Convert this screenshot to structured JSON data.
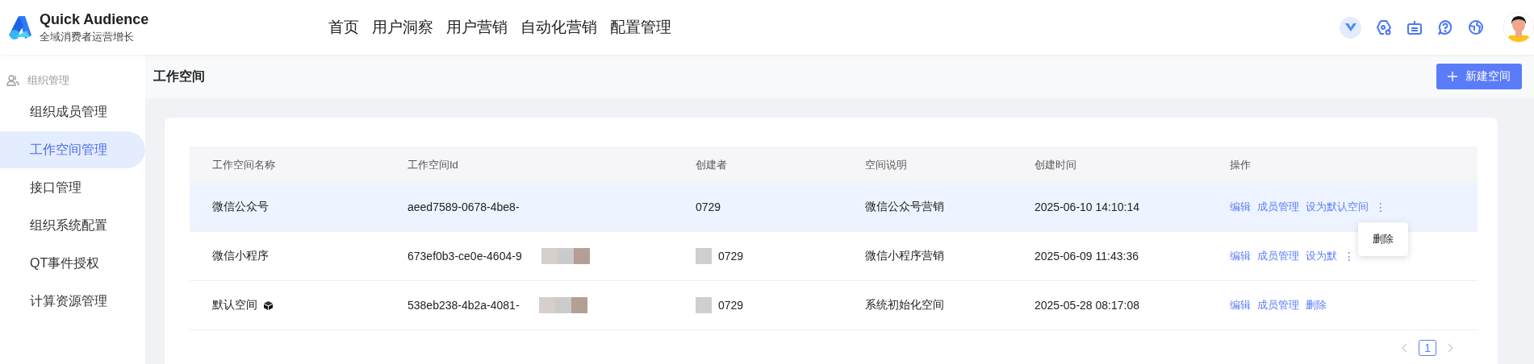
{
  "app": {
    "name": "Quick Audience",
    "tagline": "全域消费者运营增长"
  },
  "nav": [
    {
      "label": "首页"
    },
    {
      "label": "用户洞察"
    },
    {
      "label": "用户营销"
    },
    {
      "label": "自动化营销"
    },
    {
      "label": "配置管理"
    }
  ],
  "sidebar": {
    "group": "组织管理",
    "items": [
      {
        "label": "组织成员管理",
        "selected": false
      },
      {
        "label": "工作空间管理",
        "selected": true
      },
      {
        "label": "接口管理",
        "selected": false
      },
      {
        "label": "组织系统配置",
        "selected": false
      },
      {
        "label": "QT事件授权",
        "selected": false
      },
      {
        "label": "计算资源管理",
        "selected": false
      }
    ]
  },
  "page": {
    "title": "工作空间",
    "new_button": "新建空间"
  },
  "table": {
    "columns": [
      "工作空间名称",
      "工作空间Id",
      "创建者",
      "空间说明",
      "创建时间",
      "操作"
    ],
    "rows": [
      {
        "name": "微信公众号",
        "default_badge": false,
        "id": "aeed7589-0678-4be8-",
        "creator": "0729",
        "description": "微信公众号营销",
        "created": "2025-06-10 14:10:14",
        "actions": [
          "编辑",
          "成员管理",
          "设为默认空间"
        ],
        "more": "⋮",
        "hovered": true,
        "mosaic": false
      },
      {
        "name": "微信小程序",
        "default_badge": false,
        "id": "673ef0b3-ce0e-4604-9",
        "creator": "0729",
        "description": "微信小程序营销",
        "created": "2025-06-09 11:43:36",
        "actions": [
          "编辑",
          "成员管理",
          "设为默"
        ],
        "more": "⋮",
        "hovered": false,
        "mosaic": true
      },
      {
        "name": "默认空间",
        "default_badge": true,
        "id": "538eb238-4b2a-4081-",
        "creator": "0729",
        "description": "系统初始化空间",
        "created": "2025-05-28 08:17:08",
        "actions": [
          "编辑",
          "成员管理",
          "删除"
        ],
        "hovered": false,
        "mosaic": true
      }
    ]
  },
  "dropdown": {
    "items": [
      "删除"
    ]
  },
  "pagination": {
    "pages": [
      {
        "label": "1",
        "selected": true
      }
    ]
  }
}
